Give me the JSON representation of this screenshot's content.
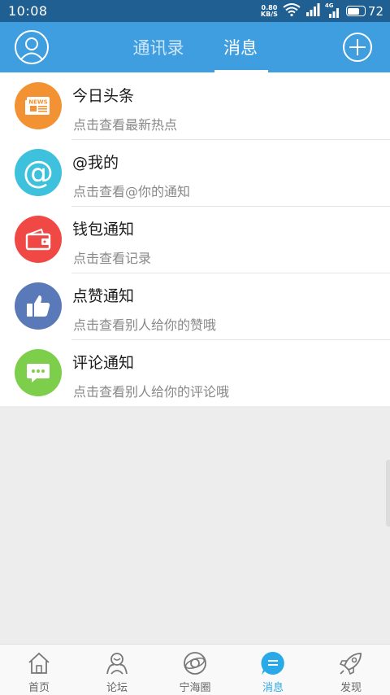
{
  "status_bar": {
    "time": "10:08",
    "net_speed_value": "0.80",
    "net_speed_unit": "KB/S",
    "network_type": "4G",
    "battery_level": "72",
    "battery_fraction": 0.72
  },
  "header": {
    "tabs": [
      {
        "label": "通讯录",
        "active": false
      },
      {
        "label": "消息",
        "active": true
      }
    ]
  },
  "messages": [
    {
      "title": "今日头条",
      "subtitle": "点击查看最新热点",
      "icon": "news-icon",
      "color": "#f39232"
    },
    {
      "title": "@我的",
      "subtitle": "点击查看@你的通知",
      "icon": "at-icon",
      "color": "#3ec1dc"
    },
    {
      "title": "钱包通知",
      "subtitle": "点击查看记录",
      "icon": "wallet-icon",
      "color": "#f04845"
    },
    {
      "title": "点赞通知",
      "subtitle": "点击查看别人给你的赞哦",
      "icon": "thumbs-up-icon",
      "color": "#5a79b9"
    },
    {
      "title": "评论通知",
      "subtitle": "点击查看别人给你的评论哦",
      "icon": "comment-icon",
      "color": "#7dce4a"
    }
  ],
  "bottom_nav": {
    "items": [
      {
        "label": "首页",
        "icon": "home-icon",
        "active": false
      },
      {
        "label": "论坛",
        "icon": "forum-icon",
        "active": false
      },
      {
        "label": "宁海圈",
        "icon": "circle-icon",
        "active": false
      },
      {
        "label": "消息",
        "icon": "message-icon",
        "active": true
      },
      {
        "label": "发现",
        "icon": "rocket-icon",
        "active": false
      }
    ],
    "active_color": "#2aa9e8"
  },
  "colors": {
    "status_bar": "#1f5f91",
    "header": "#3f9ee0"
  }
}
